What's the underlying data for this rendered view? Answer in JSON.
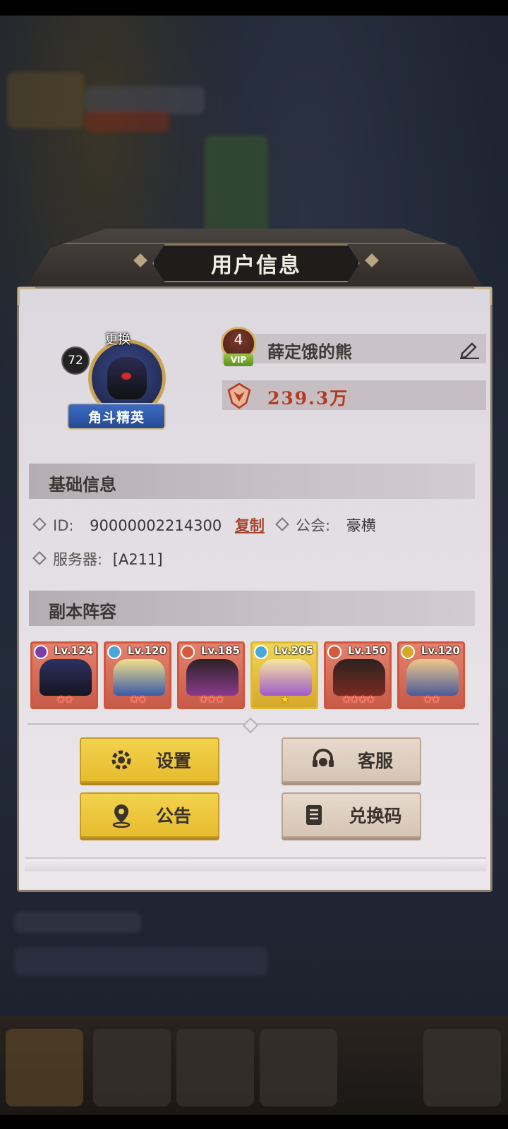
{
  "dialog": {
    "title": "用户信息"
  },
  "profile": {
    "level": "72",
    "change_label": "更换",
    "rank_title": "角斗精英",
    "vip_level": "4",
    "vip_tag": "VIP",
    "player_name": "薛定饿的熊",
    "power": "239.3万"
  },
  "basic_info": {
    "section_title": "基础信息",
    "id_label": "ID:",
    "id_value": "90000002214300",
    "copy_label": "复制",
    "guild_label": "公会:",
    "guild_value": "豪横",
    "server_label": "服务器:",
    "server_value": "[A211]"
  },
  "lineup": {
    "section_title": "副本阵容",
    "heroes": [
      {
        "level": "Lv.124",
        "stars": "★★",
        "frame": "red",
        "element_color": "#7a3ea8"
      },
      {
        "level": "Lv.120",
        "stars": "★★",
        "frame": "red",
        "element_color": "#4aa8d8"
      },
      {
        "level": "Lv.185",
        "stars": "★★★",
        "frame": "red",
        "element_color": "#d45a3a"
      },
      {
        "level": "Lv.205",
        "stars": "★",
        "frame": "gold",
        "element_color": "#4aa8d8"
      },
      {
        "level": "Lv.150",
        "stars": "★★★★",
        "frame": "red",
        "element_color": "#d45a3a"
      },
      {
        "level": "Lv.120",
        "stars": "★★",
        "frame": "red",
        "element_color": "#d6a82a"
      }
    ]
  },
  "buttons": {
    "settings": "设置",
    "service": "客服",
    "notice": "公告",
    "redeem": "兑换码"
  },
  "icons": [
    "edit-icon",
    "power-icon",
    "gear-icon",
    "headset-icon",
    "location-icon",
    "book-icon"
  ],
  "colors": {
    "accent_yellow": "#f2d24d",
    "power_red": "#b43a1c",
    "panel_bg": "#dcd8df"
  }
}
